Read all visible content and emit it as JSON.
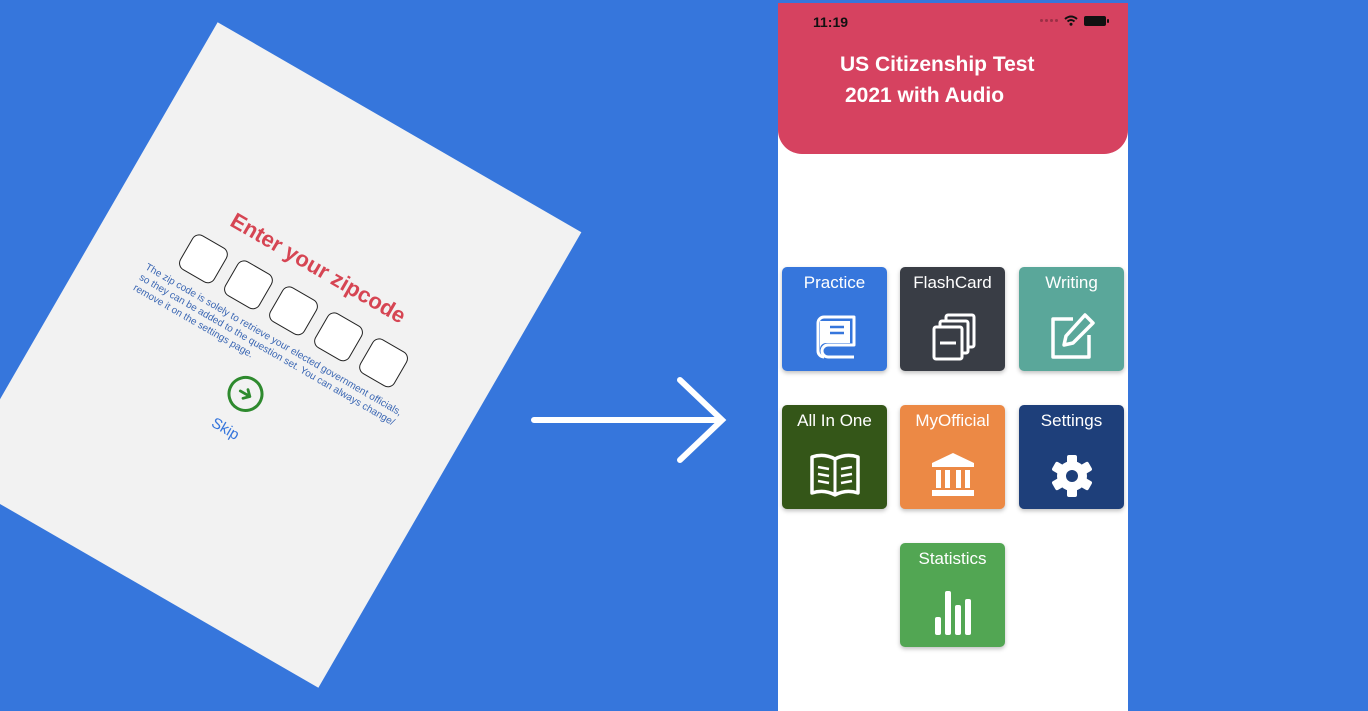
{
  "left_screen": {
    "title": "Enter your zipcode",
    "zip_boxes": [
      "",
      "",
      "",
      "",
      ""
    ],
    "note": "The zip code is solely to retrieve your elected government officials, so they can be added to the question set. You can always change/ remove it on the settings page.",
    "skip_label": "Skip",
    "icons": {
      "next": "arrow-right-circle-icon"
    },
    "colors": {
      "title": "#d64553",
      "next": "#2e8a2e",
      "link": "#3676dc"
    }
  },
  "right_screen": {
    "status_bar": {
      "time": "11:19"
    },
    "header": {
      "title_line1": "US Citizenship Test",
      "title_line2": "2021 with Audio"
    },
    "tiles": [
      {
        "label": "Practice",
        "icon": "book-icon",
        "color": "#3676dc"
      },
      {
        "label": "FlashCard",
        "icon": "cards-icon",
        "color": "#393d45"
      },
      {
        "label": "Writing",
        "icon": "edit-icon",
        "color": "#5aa79a"
      },
      {
        "label": "All In One",
        "icon": "open-book-icon",
        "color": "#345618"
      },
      {
        "label": "MyOfficial",
        "icon": "government-building-icon",
        "color": "#ec8945"
      },
      {
        "label": "Settings",
        "icon": "gear-icon",
        "color": "#1e3f7a"
      },
      {
        "label": "Statistics",
        "icon": "bar-chart-icon",
        "color": "#52a653"
      }
    ],
    "colors": {
      "header": "#d64260",
      "background": "#3676dc"
    }
  }
}
